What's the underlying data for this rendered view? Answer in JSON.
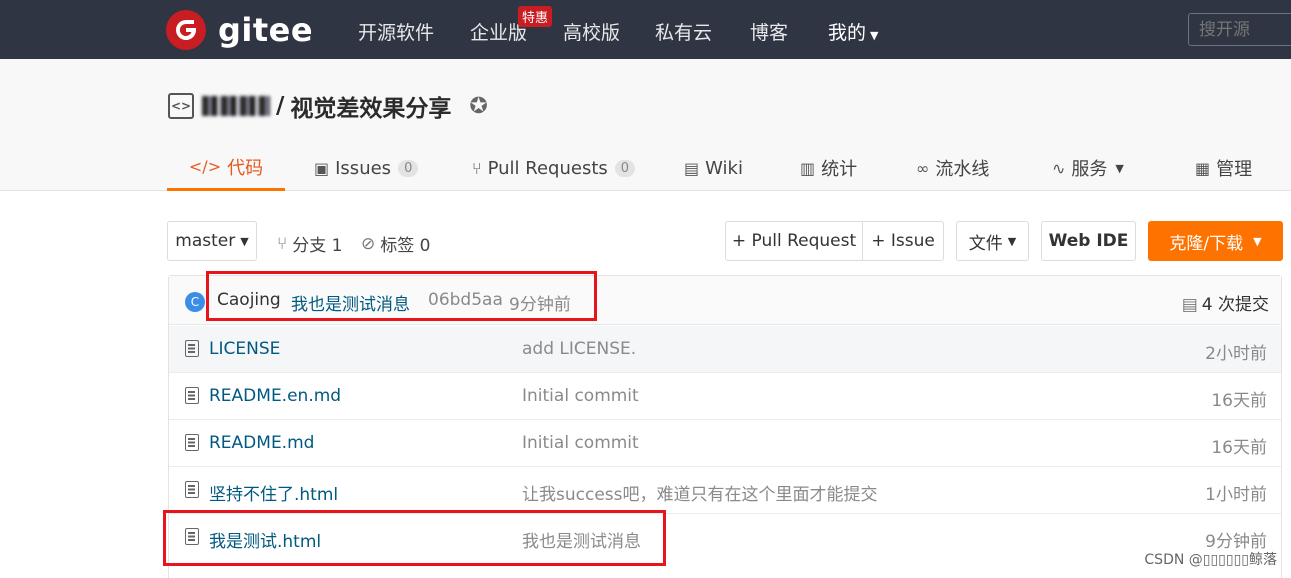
{
  "nav": {
    "logo_text": "gitee",
    "items": [
      "开源软件",
      "企业版",
      "高校版",
      "私有云",
      "博客",
      "我的"
    ],
    "badge": "特惠",
    "search_placeholder": "搜开源"
  },
  "repo": {
    "separator": "/",
    "name": "视觉差效果分享"
  },
  "tabs": [
    {
      "label": "代码",
      "icon": "code-icon"
    },
    {
      "label": "Issues",
      "count": "0",
      "icon": "issues-icon"
    },
    {
      "label": "Pull Requests",
      "count": "0",
      "icon": "pull-request-icon"
    },
    {
      "label": "Wiki",
      "icon": "wiki-icon"
    },
    {
      "label": "统计",
      "icon": "stats-icon"
    },
    {
      "label": "流水线",
      "icon": "pipeline-icon"
    },
    {
      "label": "服务",
      "icon": "service-icon"
    },
    {
      "label": "管理",
      "icon": "manage-icon"
    }
  ],
  "toolbar": {
    "branch": "master",
    "branches": "分支 1",
    "tags": "标签 0",
    "pull_request": "+ Pull Request",
    "issue": "+ Issue",
    "file": "文件",
    "web_ide": "Web IDE",
    "clone": "克隆/下载"
  },
  "commit": {
    "avatar_letter": "C",
    "author": "Caojing",
    "message": "我也是测试消息",
    "hash": "06bd5aa",
    "time": "9分钟前",
    "count": "4 次提交"
  },
  "files": [
    {
      "name": "LICENSE",
      "message": "add LICENSE.",
      "time": "2小时前"
    },
    {
      "name": "README.en.md",
      "message": "Initial commit",
      "time": "16天前"
    },
    {
      "name": "README.md",
      "message": "Initial commit",
      "time": "16天前"
    },
    {
      "name": "坚持不住了.html",
      "message": "让我success吧，难道只有在这个里面才能提交",
      "time": "1小时前"
    },
    {
      "name": "我是测试.html",
      "message": "我也是测试消息",
      "time": "9分钟前"
    }
  ],
  "watermark": "CSDN @▯▯▯▯▯▯鲸落",
  "colors": {
    "nav_bg": "#2f3542",
    "brand_red": "#c71d23",
    "accent_orange": "#fe7300",
    "annotation_red": "#e8141b"
  }
}
